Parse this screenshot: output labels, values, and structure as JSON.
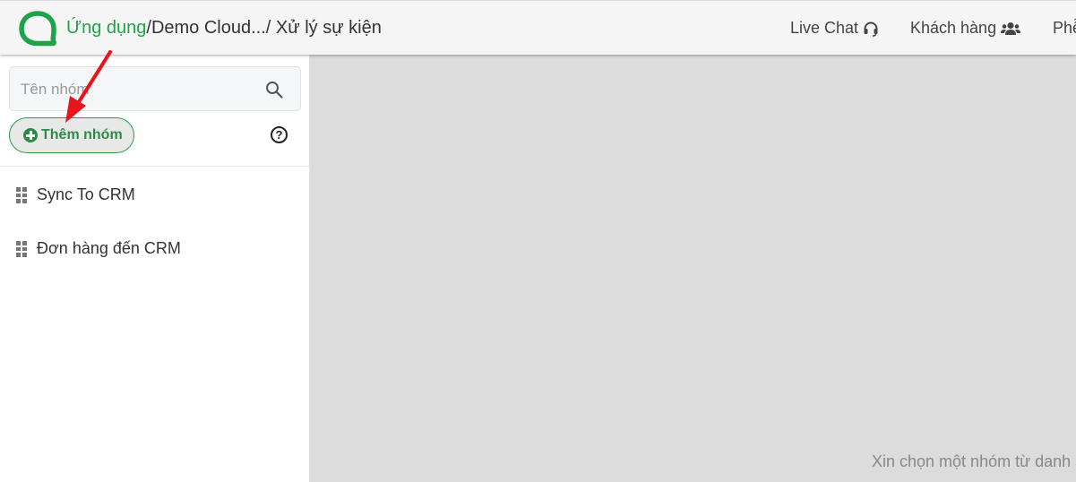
{
  "header": {
    "breadcrumb": {
      "app": "Ứng dụng",
      "separator1": "/",
      "project": "Demo Cloud...",
      "separator2": "/ ",
      "page": "Xử lý sự kiện"
    },
    "nav": [
      {
        "label": "Live Chat",
        "icon": "headset-icon"
      },
      {
        "label": "Khách hàng",
        "icon": "users-icon"
      },
      {
        "label": "Phễ"
      }
    ],
    "brand_color": "#1fa34a"
  },
  "sidebar": {
    "search": {
      "placeholder": "Tên nhóm",
      "value": ""
    },
    "add_group_label": "Thêm nhóm",
    "help_label": "?",
    "groups": [
      {
        "label": "Sync To CRM"
      },
      {
        "label": "Đơn hàng đến CRM"
      }
    ]
  },
  "main": {
    "empty_message": "Xin chọn một nhóm từ danh s"
  }
}
